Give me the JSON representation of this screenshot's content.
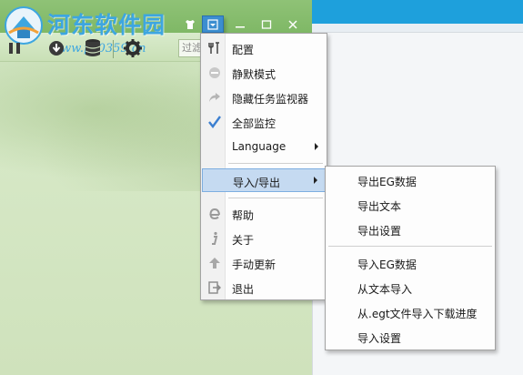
{
  "watermark": {
    "title": "河东软件园",
    "url": "www.pc0359.cn"
  },
  "toolbar": {
    "filter_placeholder": "过滤"
  },
  "main_menu": {
    "items": [
      {
        "label": "配置",
        "icon": "wrench-fork-icon"
      },
      {
        "label": "静默模式",
        "icon": "no-entry-icon"
      },
      {
        "label": "隐藏任务监视器",
        "icon": "share-arrow-icon"
      },
      {
        "label": "全部监控",
        "icon": "checkmark-icon"
      },
      {
        "label": "Language",
        "icon": ""
      },
      {
        "label": "导入/导出",
        "icon": ""
      },
      {
        "label": "帮助",
        "icon": "e-help-icon"
      },
      {
        "label": "关于",
        "icon": "info-icon"
      },
      {
        "label": "手动更新",
        "icon": "up-arrow-icon"
      },
      {
        "label": "退出",
        "icon": "exit-icon"
      }
    ]
  },
  "sub_menu": {
    "items": [
      {
        "label": "导出EG数据"
      },
      {
        "label": "导出文本"
      },
      {
        "label": "导出设置"
      },
      {
        "label": "导入EG数据"
      },
      {
        "label": "从文本导入"
      },
      {
        "label": "从.egt文件导入下载进度"
      },
      {
        "label": "导入设置"
      }
    ]
  },
  "colors": {
    "accent": "#3c8ed0",
    "watermark": "#3da6e0",
    "highlight": "#c5daf1",
    "check": "#3c7fd0"
  }
}
